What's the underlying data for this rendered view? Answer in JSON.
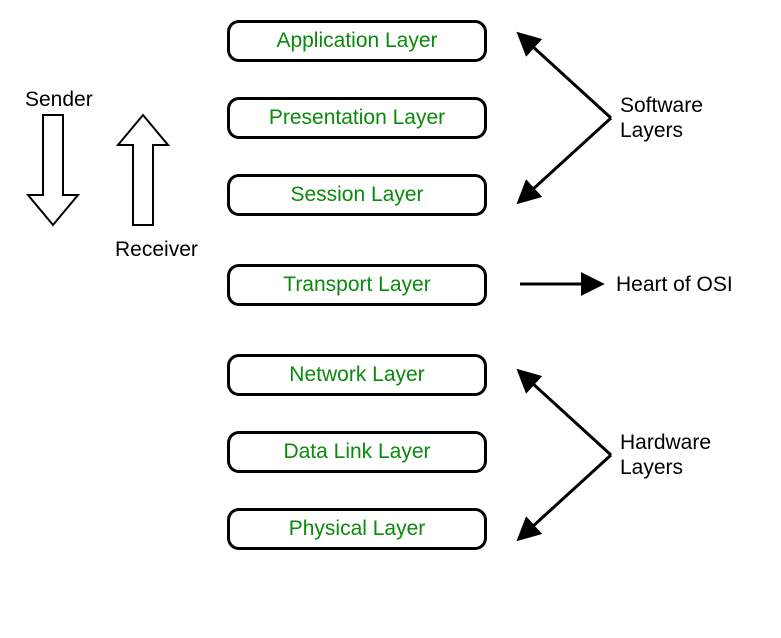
{
  "layers": [
    {
      "name": "Application Layer"
    },
    {
      "name": "Presentation Layer"
    },
    {
      "name": "Session Layer"
    },
    {
      "name": "Transport Layer"
    },
    {
      "name": "Network Layer"
    },
    {
      "name": "Data Link Layer"
    },
    {
      "name": "Physical Layer"
    }
  ],
  "labels": {
    "sender": "Sender",
    "receiver": "Receiver",
    "software": "Software",
    "layers_word": "Layers",
    "heart": "Heart of OSI",
    "hardware": "Hardware"
  }
}
